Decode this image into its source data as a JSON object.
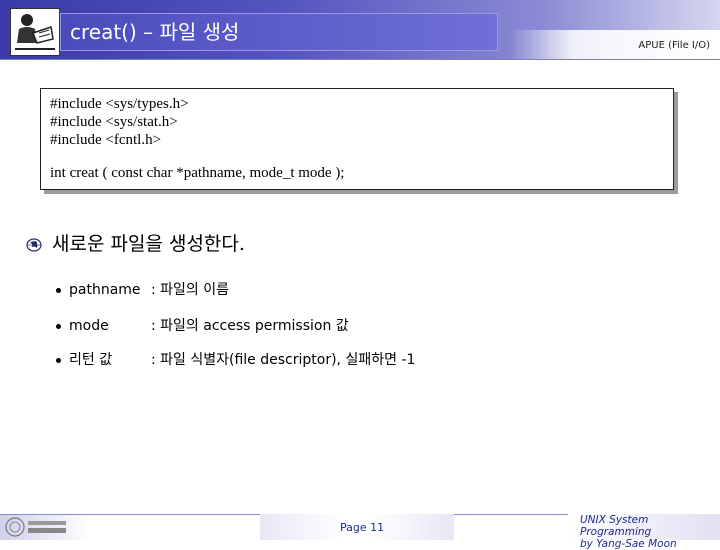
{
  "header": {
    "title": "creat() – 파일 생성",
    "right_label": "APUE (File I/O)",
    "logo_icon": "reading-person-logo-icon"
  },
  "code": {
    "lines": [
      "#include <sys/types.h>",
      "#include <sys/stat.h>",
      "#include <fcntl.h>",
      "int creat ( const char *pathname, mode_t mode );"
    ]
  },
  "main_bullet": {
    "icon": "globe-bullet-icon",
    "text": "새로운 파일을 생성한다."
  },
  "sub_items": [
    {
      "label": "pathname",
      "desc": ": 파일의 이름"
    },
    {
      "label": "mode",
      "desc": ": 파일의 access permission 값"
    },
    {
      "label": "리턴 값",
      "desc": ": 파일 식별자(file descriptor), 실패하면 -1"
    }
  ],
  "footer": {
    "page": "Page 11",
    "course_line1": "UNIX System Programming",
    "course_line2": "by Yang-Sae Moon",
    "university_logo": "university-logo-icon"
  },
  "colors": {
    "header_blue": "#4b4bbd",
    "footer_text": "#1e2a8a"
  }
}
